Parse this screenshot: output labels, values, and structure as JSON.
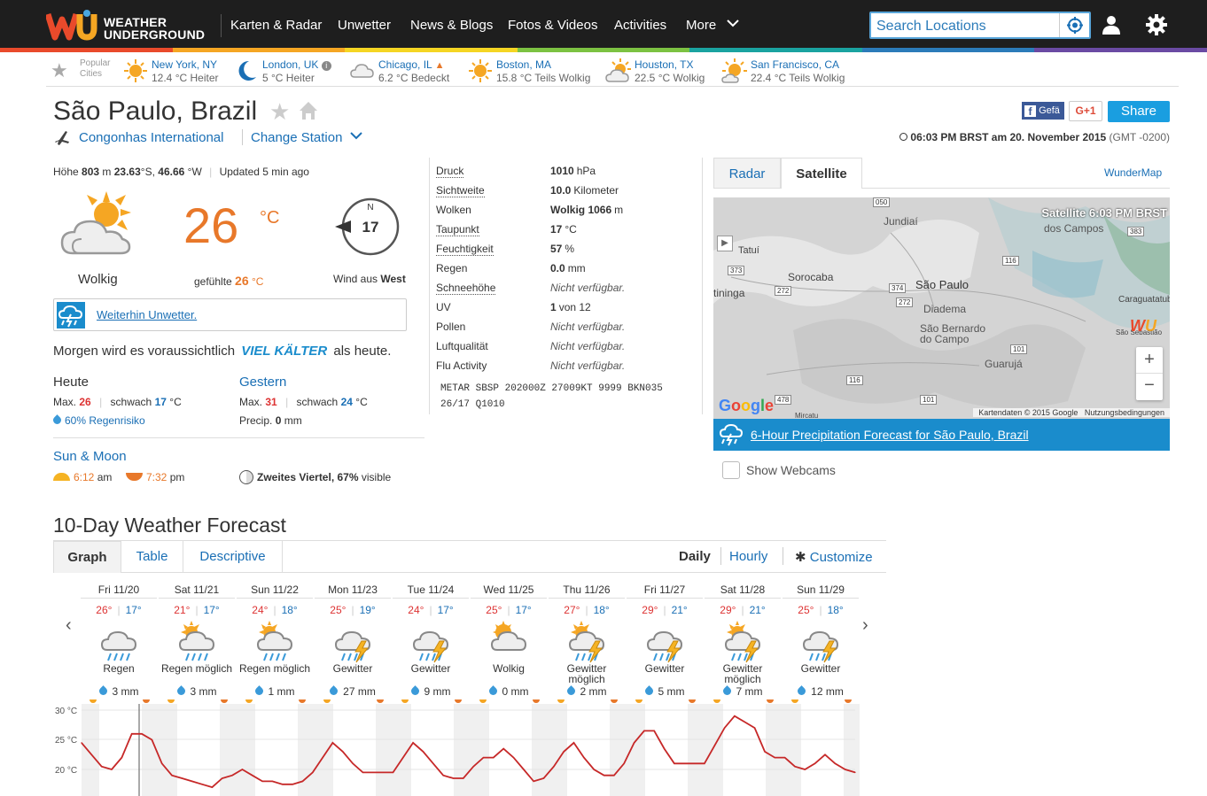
{
  "header": {
    "logo_mark": "wu",
    "logo_line1": "WEATHER",
    "logo_line2": "UNDERGROUND",
    "nav": [
      "Karten & Radar",
      "Unwetter",
      "News & Blogs",
      "Fotos & Videos",
      "Activities",
      "More"
    ],
    "search_placeholder": "Search Locations"
  },
  "popular": {
    "label_line1": "Popular",
    "label_line2": "Cities",
    "cities": [
      {
        "city": "New York, NY",
        "cond": "12.4 °C Heiter",
        "icon": "sun-icon"
      },
      {
        "city": "London, UK",
        "cond": "5 °C Heiter",
        "icon": "moon-icon"
      },
      {
        "city": "Chicago, IL",
        "cond": "6.2 °C Bedeckt",
        "icon": "cloud-icon"
      },
      {
        "city": "Boston, MA",
        "cond": "15.8 °C Teils Wolkig",
        "icon": "sun-icon"
      },
      {
        "city": "Houston, TX",
        "cond": "22.5 °C Wolkig",
        "icon": "partly-cloudy-icon"
      },
      {
        "city": "San Francisco, CA",
        "cond": "22.4 °C Teils Wolkig",
        "icon": "partly-cloudy-icon"
      }
    ]
  },
  "location": {
    "title": "São Paulo, Brazil",
    "station": "Congonhas International",
    "change_station": "Change Station",
    "time": "06:03 PM BRST am 20. November 2015",
    "gmt": "(GMT -0200)",
    "social": {
      "fb": "Gefä",
      "gplus": "G+1",
      "share": "Share"
    }
  },
  "current": {
    "elev_label": "Höhe",
    "elev": "803",
    "elev_unit": "m",
    "lat": "23.63",
    "lat_unit": "°S,",
    "lon": "46.66",
    "lon_unit": "°W",
    "updated": "Updated 5 min ago",
    "condition": "Wolkig",
    "temp": "26",
    "temp_unit": "°C",
    "feels_label": "gefühlte",
    "feels": "26",
    "feels_unit": "°C",
    "wind_dir_label": "N",
    "wind_speed": "17",
    "wind_label": "Wind aus",
    "wind_dir": "West",
    "alert": "Weiterhin Unwetter.",
    "tomorrow_pre": "Morgen wird es voraussichtlich",
    "tomorrow_em": "VIEL KÄLTER",
    "tomorrow_post": "als heute."
  },
  "today": {
    "label": "Heute",
    "max_label": "Max.",
    "max": "26",
    "sep": "|",
    "wind_label": "schwach",
    "wind": "17",
    "unit": "°C",
    "rain": "60% Regenrisiko"
  },
  "yesterday": {
    "label": "Gestern",
    "max_label": "Max.",
    "max": "31",
    "sep": "|",
    "wind_label": "schwach",
    "wind": "24",
    "unit": "°C",
    "precip_label": "Precip.",
    "precip": "0",
    "precip_unit": "mm"
  },
  "sunmoon": {
    "label": "Sun & Moon",
    "sunrise": "6:12",
    "sunrise_suffix": "am",
    "sunset": "7:32",
    "sunset_suffix": "pm",
    "moon": "Zweites Viertel, 67%",
    "moon_suffix": "visible"
  },
  "conditions": [
    {
      "label": "Druck",
      "value": "1010",
      "unit": "hPa",
      "dotted": true
    },
    {
      "label": "Sichtweite",
      "value": "10.0",
      "unit": "Kilometer",
      "dotted": true
    },
    {
      "label": "Wolken",
      "value": "Wolkig 1066",
      "unit": "m",
      "dotted": false
    },
    {
      "label": "Taupunkt",
      "value": "17",
      "unit": "°C",
      "dotted": true
    },
    {
      "label": "Feuchtigkeit",
      "value": "57",
      "unit": "%",
      "dotted": true
    },
    {
      "label": "Regen",
      "value": "0.0",
      "unit": "mm",
      "dotted": false
    },
    {
      "label": "Schneehöhe",
      "value": "Nicht verfügbar.",
      "unit": "",
      "dotted": true,
      "na": true
    },
    {
      "label": "UV",
      "value": "1",
      "unit": "von 12",
      "dotted": false
    },
    {
      "label": "Pollen",
      "value": "Nicht verfügbar.",
      "unit": "",
      "dotted": false,
      "na": true
    },
    {
      "label": "Luftqualität",
      "value": "Nicht verfügbar.",
      "unit": "",
      "dotted": false,
      "na": true
    },
    {
      "label": "Flu Activity",
      "value": "Nicht verfügbar.",
      "unit": "",
      "dotted": false,
      "na": true
    }
  ],
  "metar": "METAR SBSP 202000Z 27009KT 9999 BKN035\n26/17 Q1010",
  "map": {
    "tabs": [
      "Radar",
      "Satellite"
    ],
    "active_tab": "Satellite",
    "wundermap": "WunderMap",
    "overlay": "Satellite  6:03 PM BRST",
    "places": [
      "Jundiaí",
      "dos Campos",
      "Tatuí",
      "Sorocaba",
      "São Paulo",
      "Diadema",
      "São Bernardo do Campo",
      "Guarujá",
      "Caraguatatub",
      "São Sebastião",
      "tininga",
      "Mircatu"
    ],
    "roads": [
      "050",
      "373",
      "272",
      "374",
      "116",
      "101",
      "383",
      "116",
      "272",
      "478",
      "101"
    ],
    "google": "Google",
    "attribution": "Kartendaten © 2015 Google   Nutzungsbedingungen",
    "precip_link": "6-Hour Precipitation Forecast for São Paulo, Brazil",
    "webcams": "Show Webcams"
  },
  "forecast": {
    "title": "10-Day Weather Forecast",
    "tabs": [
      "Graph",
      "Table",
      "Descriptive"
    ],
    "views": [
      "Daily",
      "Hourly"
    ],
    "customize": "Customize",
    "days": [
      {
        "day": "Fri 11/20",
        "hi": "26°",
        "lo": "17°",
        "cond": "Regen",
        "mm": "3 mm",
        "icon": "rain-icon"
      },
      {
        "day": "Sat 11/21",
        "hi": "21°",
        "lo": "17°",
        "cond": "Regen möglich",
        "mm": "3 mm",
        "icon": "chance-rain-icon"
      },
      {
        "day": "Sun 11/22",
        "hi": "24°",
        "lo": "18°",
        "cond": "Regen möglich",
        "mm": "1 mm",
        "icon": "chance-rain-icon"
      },
      {
        "day": "Mon 11/23",
        "hi": "25°",
        "lo": "19°",
        "cond": "Gewitter",
        "mm": "27 mm",
        "icon": "thunderstorm-icon"
      },
      {
        "day": "Tue 11/24",
        "hi": "24°",
        "lo": "17°",
        "cond": "Gewitter",
        "mm": "9 mm",
        "icon": "thunderstorm-icon"
      },
      {
        "day": "Wed 11/25",
        "hi": "25°",
        "lo": "17°",
        "cond": "Wolkig",
        "mm": "0 mm",
        "icon": "partly-cloudy-icon"
      },
      {
        "day": "Thu 11/26",
        "hi": "27°",
        "lo": "18°",
        "cond": "Gewitter möglich",
        "mm": "2 mm",
        "icon": "chance-thunderstorm-icon"
      },
      {
        "day": "Fri 11/27",
        "hi": "29°",
        "lo": "21°",
        "cond": "Gewitter",
        "mm": "5 mm",
        "icon": "thunderstorm-icon"
      },
      {
        "day": "Sat 11/28",
        "hi": "29°",
        "lo": "21°",
        "cond": "Gewitter möglich",
        "mm": "7 mm",
        "icon": "chance-thunderstorm-icon"
      },
      {
        "day": "Sun 11/29",
        "hi": "25°",
        "lo": "18°",
        "cond": "Gewitter",
        "mm": "12 mm",
        "icon": "thunderstorm-icon"
      }
    ]
  },
  "chart_data": {
    "type": "line",
    "title": "",
    "xlabel": "",
    "ylabel": "",
    "y_ticks": [
      "30 °C",
      "25 °C",
      "20 °C"
    ],
    "ylim": [
      17,
      30
    ],
    "series": [
      {
        "values": [
          24.5,
          22.5,
          20.5,
          20,
          22,
          26,
          26,
          25,
          21,
          19,
          18.5,
          18,
          17.5,
          17,
          18.5,
          19,
          20,
          19,
          18,
          18,
          17.5,
          17.5,
          18,
          19.5,
          22,
          24.5,
          23,
          21,
          19.5,
          19.5,
          19.5,
          19.5,
          22,
          24.5,
          23,
          21,
          19,
          18.5,
          18.5,
          20.5,
          22,
          22,
          23.5,
          22,
          20,
          18,
          18.5,
          20.5,
          23,
          24.5,
          22,
          20,
          19,
          19,
          21,
          24.5,
          26.5,
          26.5,
          23.5,
          21,
          21,
          21,
          21,
          24,
          27,
          29,
          28,
          27,
          23,
          22,
          22,
          20.5,
          20,
          21,
          22.5,
          21,
          20,
          19.5
        ]
      }
    ],
    "grid": true,
    "legend": "none"
  }
}
